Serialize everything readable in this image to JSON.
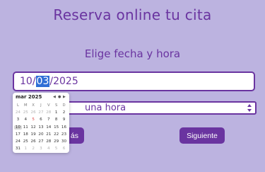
{
  "page": {
    "title": "Reserva online tu cita",
    "section_title": "Elige fecha y hora"
  },
  "date_input": {
    "day": "10",
    "sep1": "/",
    "month": "03",
    "sep2": "/",
    "year": "2025"
  },
  "time_select": {
    "value": "una hora"
  },
  "buttons": {
    "back_label": "ás",
    "next_label": "Siguiente"
  },
  "calendar": {
    "month_label": "mar 2025",
    "nav_prev": "◀",
    "nav_today": "●",
    "nav_next": "▶",
    "weekdays": [
      "L",
      "M",
      "X",
      "J",
      "V",
      "S",
      "D"
    ],
    "weeks": [
      [
        [
          "24",
          "muted"
        ],
        [
          "25",
          "muted"
        ],
        [
          "26",
          "muted"
        ],
        [
          "27",
          "muted"
        ],
        [
          "28",
          "muted"
        ],
        [
          "1",
          ""
        ],
        [
          "2",
          ""
        ]
      ],
      [
        [
          "3",
          ""
        ],
        [
          "4",
          ""
        ],
        [
          "5",
          "sun"
        ],
        [
          "6",
          ""
        ],
        [
          "7",
          ""
        ],
        [
          "8",
          ""
        ],
        [
          "9",
          ""
        ]
      ],
      [
        [
          "10",
          "sel"
        ],
        [
          "11",
          ""
        ],
        [
          "12",
          ""
        ],
        [
          "13",
          ""
        ],
        [
          "14",
          ""
        ],
        [
          "15",
          ""
        ],
        [
          "16",
          ""
        ]
      ],
      [
        [
          "17",
          ""
        ],
        [
          "18",
          ""
        ],
        [
          "19",
          ""
        ],
        [
          "20",
          ""
        ],
        [
          "21",
          ""
        ],
        [
          "22",
          ""
        ],
        [
          "23",
          ""
        ]
      ],
      [
        [
          "24",
          ""
        ],
        [
          "25",
          ""
        ],
        [
          "26",
          ""
        ],
        [
          "27",
          ""
        ],
        [
          "28",
          ""
        ],
        [
          "29",
          ""
        ],
        [
          "30",
          ""
        ]
      ],
      [
        [
          "31",
          ""
        ],
        [
          "1",
          "muted"
        ],
        [
          "2",
          "muted"
        ],
        [
          "3",
          "muted"
        ],
        [
          "4",
          "muted"
        ],
        [
          "5",
          "muted"
        ],
        [
          "6",
          "muted"
        ]
      ]
    ]
  },
  "colors": {
    "background": "#bcb3e0",
    "accent": "#6a34a0",
    "selection": "#2f6fd6"
  }
}
